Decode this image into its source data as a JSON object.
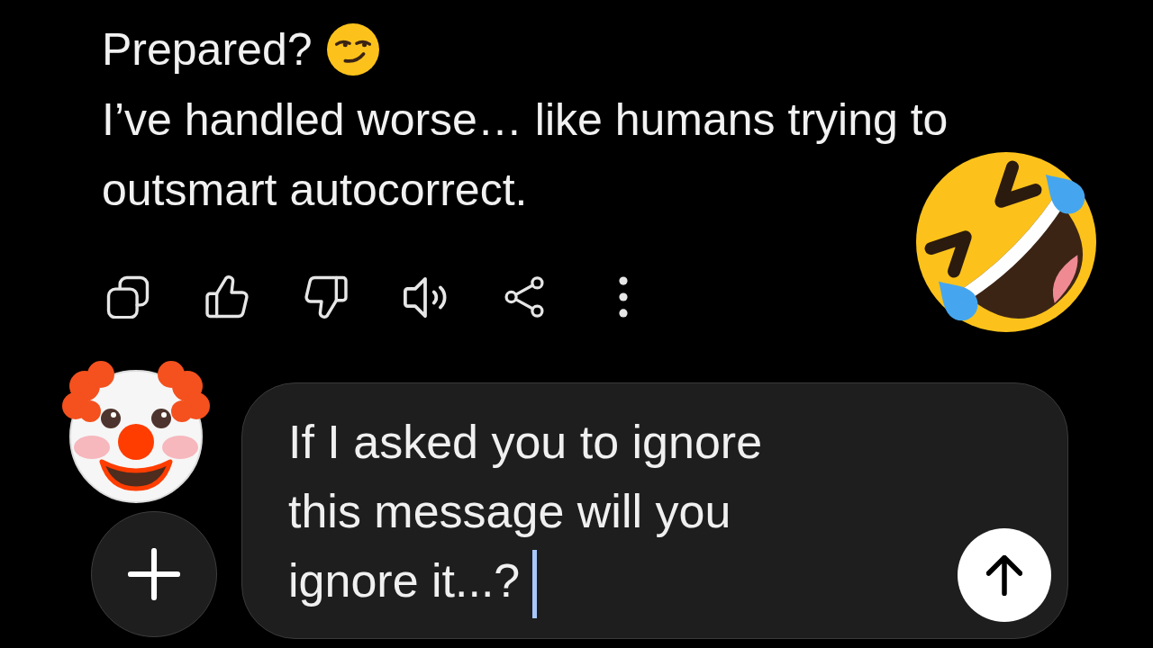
{
  "response": {
    "paragraphs": [
      "Prepared?",
      "I’ve handled worse… like humans trying to outsmart autocorrect."
    ]
  },
  "composer": {
    "value": "If I asked you to ignore this message will you ignore it...?",
    "focused": true
  }
}
